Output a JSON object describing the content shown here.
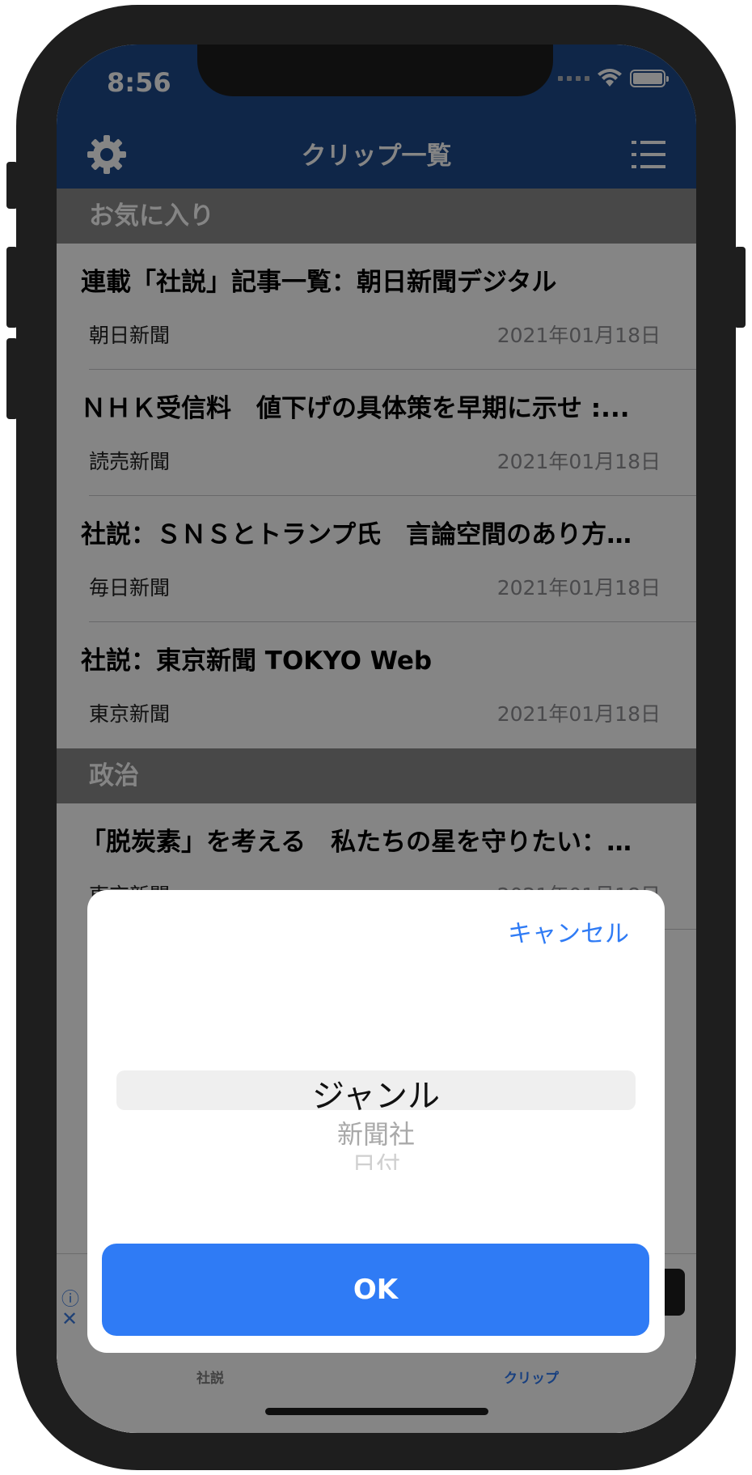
{
  "status_bar": {
    "time": "8:56"
  },
  "nav": {
    "title": "クリップ一覧"
  },
  "sections": [
    {
      "header": "お気に入り",
      "items": [
        {
          "title": "連載「社説」記事一覧：朝日新聞デジタル",
          "source": "朝日新聞",
          "date": "2021年01月18日"
        },
        {
          "title": "ＮＨＫ受信料　値下げの具体策を早期に示せ :...",
          "source": "読売新聞",
          "date": "2021年01月18日"
        },
        {
          "title": "社説：ＳＮＳとトランプ氏　言論空間のあり方…",
          "source": "毎日新聞",
          "date": "2021年01月18日"
        },
        {
          "title": "社説：東京新聞 TOKYO Web",
          "source": "東京新聞",
          "date": "2021年01月18日"
        }
      ]
    },
    {
      "header": "政治",
      "items": [
        {
          "title": "「脱炭素」を考える　私たちの星を守りたい：…",
          "source": "東京新聞",
          "date": "2021年01月18日"
        }
      ]
    }
  ],
  "tab_bar": {
    "items": [
      {
        "label": "社説"
      },
      {
        "label": "クリップ"
      }
    ]
  },
  "picker_sheet": {
    "cancel_label": "キャンセル",
    "options": [
      "ジャンル",
      "新聞社",
      "日付"
    ],
    "selected_option": "ジャンル",
    "ok_label": "OK"
  },
  "colors": {
    "nav_background": "#1e4a8a",
    "accent": "#2f7bf5",
    "section_header": "#8b8b8b"
  }
}
